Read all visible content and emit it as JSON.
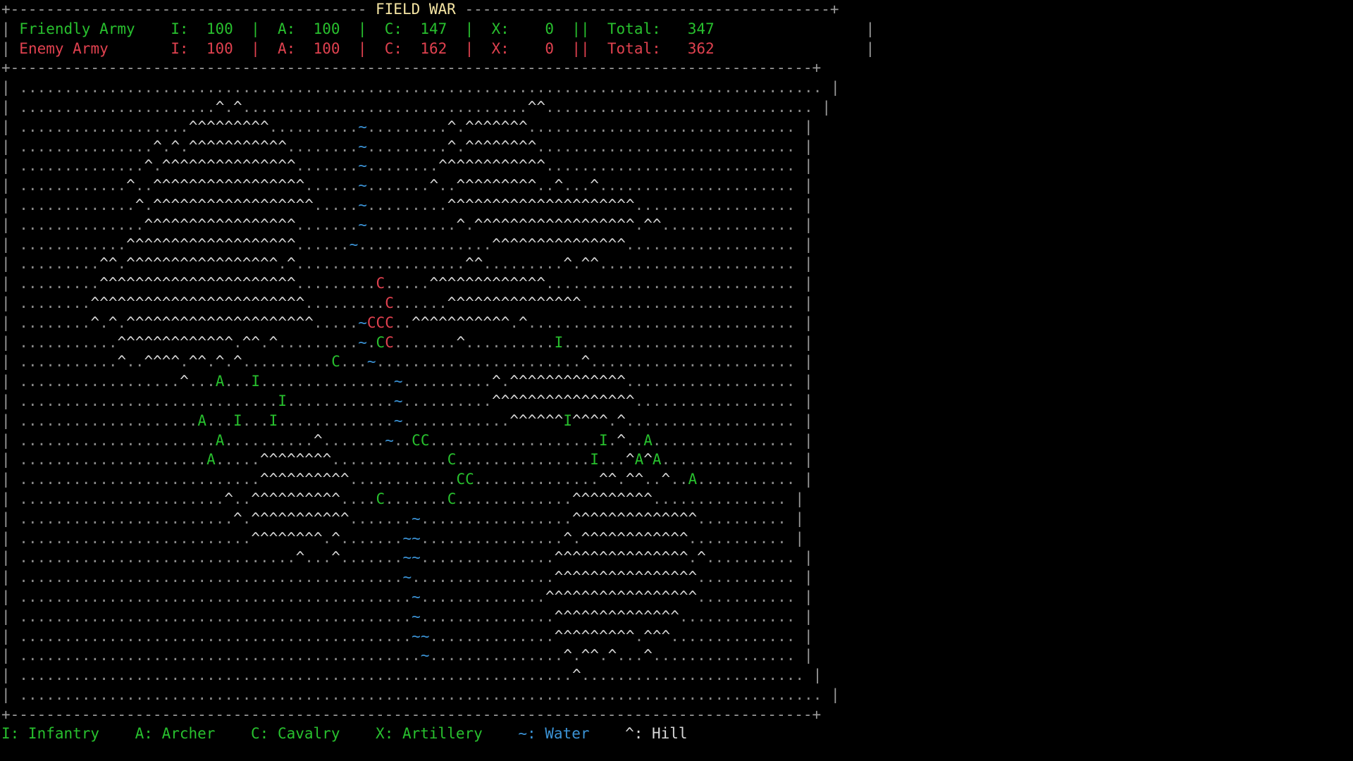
{
  "title": "FIELD WAR",
  "armies": [
    {
      "key": "friendly",
      "name": "Friendly Army",
      "infantry_label": "I:",
      "infantry": "100",
      "archer_label": "A:",
      "archer": "100",
      "cavalry_label": "C:",
      "cavalry": "147",
      "artillery_label": "X:",
      "artillery": "0",
      "total_label": "Total:",
      "total": "347"
    },
    {
      "key": "enemy",
      "name": "Enemy Army",
      "infantry_label": "I:",
      "infantry": "100",
      "archer_label": "A:",
      "archer": "100",
      "cavalry_label": "C:",
      "cavalry": "162",
      "artillery_label": "X:",
      "artillery": "0",
      "total_label": "Total:",
      "total": "362"
    }
  ],
  "map_rows": [
    "..........................................................................................",
    "......................^.^................................^^..............................",
    "...................^^^^^^^^^..........~.........^.^^^^^^^..............................",
    "...............^.^.^^^^^^^^^^^........~.........^.^^^^^^^^.............................",
    "..............^.^^^^^^^^^^^^^^^.......~........^^^^^^^^^^^^............................",
    "............^..^^^^^^^^^^^^^^^^^......~.......^..^^^^^^^^^..^...^......................",
    ".............^.^^^^^^^^^^^^^^^^^^.....~.........^^^^^^^^^^^^^^^^^^^^^..................",
    "..............^^^^^^^^^^^^^^^^^.......~..........^.^^^^^^^^^^^^^^^^^^.^^...............",
    "............^^^^^^^^^^^^^^^^^^^......~...............^^^^^^^^^^^^^^^...................",
    ".........^^.^^^^^^^^^^^^^^^^^.^...................^^.........^.^^......................",
    ".........^^^^^^^^^^^^^^^^^^^^^^.........C.....^^^^^^^^^^^^^............................",
    "........^^^^^^^^^^^^^^^^^^^^^^^^.........C......^^^^^^^^^^^^^^^........................",
    "........^.^.^^^^^^^^^^^^^^^^^^^^^.....~CCC..^^^^^^^^^^^.^..............................",
    "...........^^^^^^^^^^^^^.^^.^.........~.CC.......^..........I..........................",
    "...........^..^^^^.^^.^.^..........C...~.......................^.......................",
    "..................^...A...I...............~..........^.^^^^^^^^^^^^^...................",
    ".............................I............~..........^^^^^^^^^^^^^^^^..................",
    "....................A...I...I.............~............^^^^^^I^^^^.^...................",
    "......................A..........^.......~..CC...................I.^..A................",
    ".....................A.....^^^^^^^^.............C...............I...^A^A...............",
    "...........................^^^^^^^^^^............CC..............^^.^^..^..A...........",
    ".......................^..^^^^^^^^^^....C.......C.............^^^^^^^^^...............",
    "........................^.^^^^^^^^^^^.......~.................^^^^^^^^^^^^^^..........",
    "..........................^^^^^^^^.^.......~~................^.^^^^^^^^^^^^...........",
    "...............................^...^.......~~...............^^^^^^^^^^^^^^^.^..........",
    "...........................................~................^^^^^^^^^^^^^^^^...........",
    "............................................~..............^^^^^^^^^^^^^^^^^...........",
    "............................................~...............^^^^^^^^^^^^^^.............",
    "............................................~~..............^^^^^^^^^.^^^..............",
    ".............................................~...............^.^^.^...^................",
    "..............................................................^.........................",
    ".........................................................................................."
  ],
  "unit_colors": {
    "friendly_cells": [
      [
        10,
        40
      ],
      [
        14,
        35
      ],
      [
        15,
        22
      ],
      [
        15,
        26
      ],
      [
        16,
        29
      ],
      [
        17,
        20
      ],
      [
        17,
        24
      ],
      [
        17,
        28
      ],
      [
        18,
        22
      ],
      [
        18,
        45
      ],
      [
        18,
        46
      ],
      [
        19,
        21
      ],
      [
        19,
        48
      ],
      [
        20,
        50
      ],
      [
        21,
        40
      ],
      [
        21,
        48
      ]
    ],
    "enemy_cells": [
      [
        10,
        40
      ],
      [
        11,
        41
      ],
      [
        12,
        39
      ],
      [
        12,
        40
      ],
      [
        12,
        41
      ],
      [
        13,
        41
      ],
      [
        13,
        42
      ],
      [
        13,
        61
      ],
      [
        17,
        62
      ],
      [
        18,
        66
      ],
      [
        18,
        71
      ],
      [
        19,
        65
      ],
      [
        19,
        70
      ],
      [
        19,
        72
      ],
      [
        20,
        77
      ]
    ]
  },
  "legend": {
    "infantry": "I: Infantry",
    "archer": "A: Archer",
    "cavalry": "C: Cavalry",
    "artillery": "X: Artillery",
    "water": "~: Water",
    "hill": "^: Hill"
  },
  "colors": {
    "friendly": "#28c02e",
    "enemy": "#e0414f",
    "water": "#3b93d6",
    "hill": "#d8d8d8",
    "plain": "#8a8a8a",
    "title": "#f5e5a3"
  }
}
